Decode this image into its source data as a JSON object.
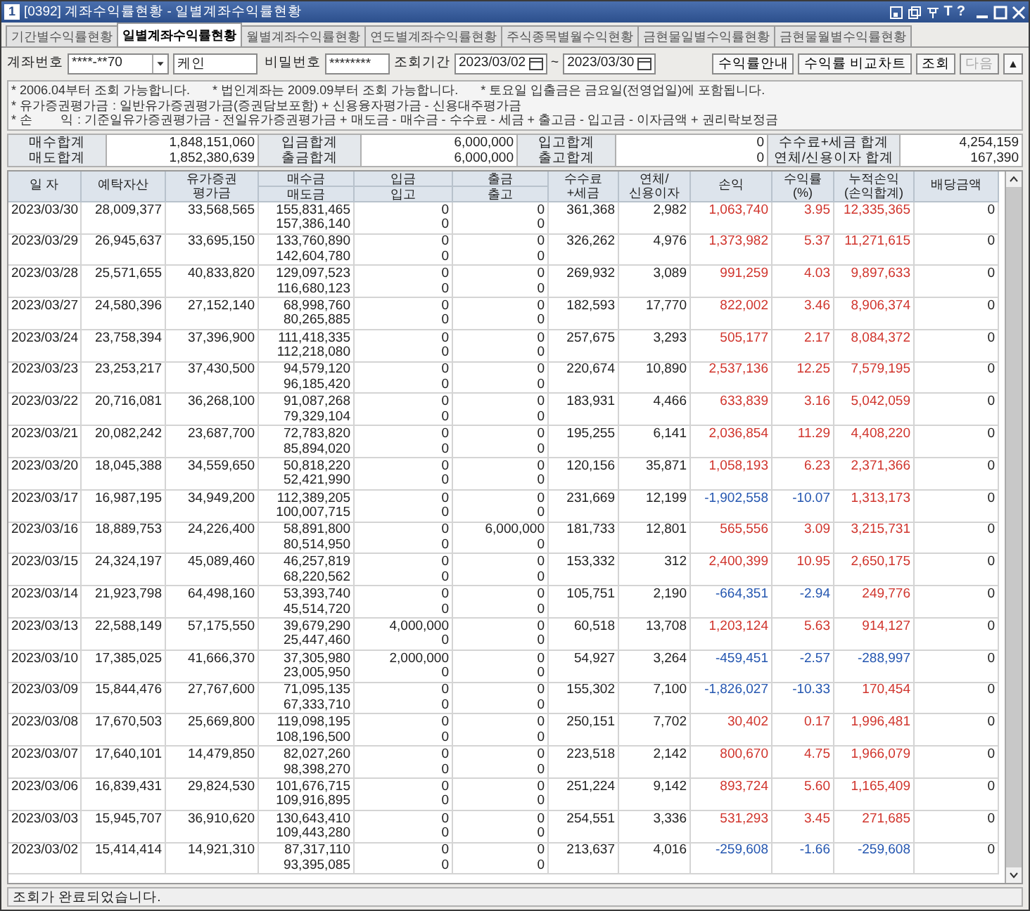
{
  "window": {
    "badge": "1",
    "title": "[0392] 계좌수익률현황 - 일별계좌수익률현황",
    "letter_button": "T",
    "help_button": "?"
  },
  "tabs": [
    {
      "label": "기간별수익률현황",
      "selected": false
    },
    {
      "label": "일별계좌수익률현황",
      "selected": true
    },
    {
      "label": "월별계좌수익률현황",
      "selected": false
    },
    {
      "label": "연도별계좌수익률현황",
      "selected": false
    },
    {
      "label": "주식종목별월수익현황",
      "selected": false
    },
    {
      "label": "금현물일별수익률현황",
      "selected": false
    },
    {
      "label": "금현물월별수익률현황",
      "selected": false
    }
  ],
  "query": {
    "account_label": "계좌번호",
    "account": "****-**70",
    "owner": "케인",
    "password_label": "비밀번호",
    "password": "********",
    "period_label": "조회기간",
    "from": "2023/03/02",
    "separator": "~",
    "to": "2023/03/30",
    "buttons": [
      {
        "label": "수익률안내",
        "disabled": false
      },
      {
        "label": "수익률 비교차트",
        "disabled": false
      },
      {
        "label": "조회",
        "disabled": false
      },
      {
        "label": "다음",
        "disabled": true
      }
    ],
    "collapse": "▲"
  },
  "notes": {
    "info": [
      "* 2006.04부터 조회 가능합니다.",
      "* 법인계좌는 2009.09부터 조회 가능합니다.",
      "* 토요일 입출금은 금요일(전영업일)에 포함됩니다."
    ],
    "formulas": [
      {
        "label": "* 유가증권평가금",
        "text": ": 일반유가증권평가금(증권담보포함) + 신용융자평가금 - 신용대주평가금"
      },
      {
        "label": "* 손        익",
        "text": ": 기준일유가증권평가금 - 전일유가증권평가금 + 매도금 - 매수금 - 수수료 - 세금 + 출고금 - 입고금 - 이자금액 + 권리락보정금"
      }
    ]
  },
  "summary": [
    [
      {
        "label": "매수합계",
        "value": "1,848,151,060"
      },
      {
        "label": "입금합계",
        "value": "6,000,000"
      },
      {
        "label": "입고합계",
        "value": "0"
      },
      {
        "label": "수수료+세금 합계",
        "value": "4,254,159"
      }
    ],
    [
      {
        "label": "매도합계",
        "value": "1,852,380,639"
      },
      {
        "label": "출금합계",
        "value": "6,000,000"
      },
      {
        "label": "출고합계",
        "value": "0"
      },
      {
        "label": "연체/신용이자 합계",
        "value": "167,390"
      }
    ]
  ],
  "table": {
    "columns": [
      {
        "kind": "single",
        "lines": [
          "일 자"
        ]
      },
      {
        "kind": "single",
        "lines": [
          "예탁자산"
        ]
      },
      {
        "kind": "stacked",
        "lines": [
          "유가증권",
          "평가금"
        ]
      },
      {
        "kind": "split",
        "lines": [
          "매수금",
          "매도금"
        ]
      },
      {
        "kind": "split",
        "lines": [
          "입금",
          "입고"
        ]
      },
      {
        "kind": "split",
        "lines": [
          "출금",
          "출고"
        ]
      },
      {
        "kind": "stacked",
        "lines": [
          "수수료",
          "+세금"
        ]
      },
      {
        "kind": "stacked",
        "lines": [
          "연체/",
          "신용이자"
        ]
      },
      {
        "kind": "single",
        "lines": [
          "손익"
        ]
      },
      {
        "kind": "stacked",
        "lines": [
          "수익률",
          "(%)"
        ]
      },
      {
        "kind": "stacked",
        "lines": [
          "누적손익",
          "(손익합계)"
        ]
      },
      {
        "kind": "single",
        "lines": [
          "배당금액"
        ]
      }
    ],
    "rows": [
      {
        "date": "2023/03/30",
        "deposit": "28,009,377",
        "valuation": "33,568,565",
        "buy": "155,831,465",
        "sell": "157,386,140",
        "cash_in": "0",
        "stock_in": "0",
        "cash_out": "0",
        "stock_out": "0",
        "fee": "361,368",
        "interest": "2,982",
        "pl": {
          "text": "1,063,740",
          "color": "#d0342c"
        },
        "rate": {
          "text": "3.95",
          "color": "#d0342c"
        },
        "cum": {
          "text": "12,335,365",
          "color": "#d0342c"
        },
        "dividend": "0"
      },
      {
        "date": "2023/03/29",
        "deposit": "26,945,637",
        "valuation": "33,695,150",
        "buy": "133,760,890",
        "sell": "142,604,780",
        "cash_in": "0",
        "stock_in": "0",
        "cash_out": "0",
        "stock_out": "0",
        "fee": "326,262",
        "interest": "4,976",
        "pl": {
          "text": "1,373,982",
          "color": "#d0342c"
        },
        "rate": {
          "text": "5.37",
          "color": "#d0342c"
        },
        "cum": {
          "text": "11,271,615",
          "color": "#d0342c"
        },
        "dividend": "0"
      },
      {
        "date": "2023/03/28",
        "deposit": "25,571,655",
        "valuation": "40,833,820",
        "buy": "129,097,523",
        "sell": "116,680,123",
        "cash_in": "0",
        "stock_in": "0",
        "cash_out": "0",
        "stock_out": "0",
        "fee": "269,932",
        "interest": "3,089",
        "pl": {
          "text": "991,259",
          "color": "#d0342c"
        },
        "rate": {
          "text": "4.03",
          "color": "#d0342c"
        },
        "cum": {
          "text": "9,897,633",
          "color": "#d0342c"
        },
        "dividend": "0"
      },
      {
        "date": "2023/03/27",
        "deposit": "24,580,396",
        "valuation": "27,152,140",
        "buy": "68,998,760",
        "sell": "80,265,885",
        "cash_in": "0",
        "stock_in": "0",
        "cash_out": "0",
        "stock_out": "0",
        "fee": "182,593",
        "interest": "17,770",
        "pl": {
          "text": "822,002",
          "color": "#d0342c"
        },
        "rate": {
          "text": "3.46",
          "color": "#d0342c"
        },
        "cum": {
          "text": "8,906,374",
          "color": "#d0342c"
        },
        "dividend": "0"
      },
      {
        "date": "2023/03/24",
        "deposit": "23,758,394",
        "valuation": "37,396,900",
        "buy": "111,418,335",
        "sell": "112,218,080",
        "cash_in": "0",
        "stock_in": "0",
        "cash_out": "0",
        "stock_out": "0",
        "fee": "257,675",
        "interest": "3,293",
        "pl": {
          "text": "505,177",
          "color": "#d0342c"
        },
        "rate": {
          "text": "2.17",
          "color": "#d0342c"
        },
        "cum": {
          "text": "8,084,372",
          "color": "#d0342c"
        },
        "dividend": "0"
      },
      {
        "date": "2023/03/23",
        "deposit": "23,253,217",
        "valuation": "37,430,500",
        "buy": "94,579,120",
        "sell": "96,185,420",
        "cash_in": "0",
        "stock_in": "0",
        "cash_out": "0",
        "stock_out": "0",
        "fee": "220,674",
        "interest": "10,890",
        "pl": {
          "text": "2,537,136",
          "color": "#d0342c"
        },
        "rate": {
          "text": "12.25",
          "color": "#d0342c"
        },
        "cum": {
          "text": "7,579,195",
          "color": "#d0342c"
        },
        "dividend": "0"
      },
      {
        "date": "2023/03/22",
        "deposit": "20,716,081",
        "valuation": "36,268,100",
        "buy": "91,087,268",
        "sell": "79,329,104",
        "cash_in": "0",
        "stock_in": "0",
        "cash_out": "0",
        "stock_out": "0",
        "fee": "183,931",
        "interest": "4,466",
        "pl": {
          "text": "633,839",
          "color": "#d0342c"
        },
        "rate": {
          "text": "3.16",
          "color": "#d0342c"
        },
        "cum": {
          "text": "5,042,059",
          "color": "#d0342c"
        },
        "dividend": "0"
      },
      {
        "date": "2023/03/21",
        "deposit": "20,082,242",
        "valuation": "23,687,700",
        "buy": "72,783,820",
        "sell": "85,894,020",
        "cash_in": "0",
        "stock_in": "0",
        "cash_out": "0",
        "stock_out": "0",
        "fee": "195,255",
        "interest": "6,141",
        "pl": {
          "text": "2,036,854",
          "color": "#d0342c"
        },
        "rate": {
          "text": "11.29",
          "color": "#d0342c"
        },
        "cum": {
          "text": "4,408,220",
          "color": "#d0342c"
        },
        "dividend": "0"
      },
      {
        "date": "2023/03/20",
        "deposit": "18,045,388",
        "valuation": "34,559,650",
        "buy": "50,818,220",
        "sell": "52,421,990",
        "cash_in": "0",
        "stock_in": "0",
        "cash_out": "0",
        "stock_out": "0",
        "fee": "120,156",
        "interest": "35,871",
        "pl": {
          "text": "1,058,193",
          "color": "#d0342c"
        },
        "rate": {
          "text": "6.23",
          "color": "#d0342c"
        },
        "cum": {
          "text": "2,371,366",
          "color": "#d0342c"
        },
        "dividend": "0"
      },
      {
        "date": "2023/03/17",
        "deposit": "16,987,195",
        "valuation": "34,949,200",
        "buy": "112,389,205",
        "sell": "100,007,715",
        "cash_in": "0",
        "stock_in": "0",
        "cash_out": "0",
        "stock_out": "0",
        "fee": "231,669",
        "interest": "12,199",
        "pl": {
          "text": "-1,902,558",
          "color": "#2456b0"
        },
        "rate": {
          "text": "-10.07",
          "color": "#2456b0"
        },
        "cum": {
          "text": "1,313,173",
          "color": "#d0342c"
        },
        "dividend": "0"
      },
      {
        "date": "2023/03/16",
        "deposit": "18,889,753",
        "valuation": "24,226,400",
        "buy": "58,891,800",
        "sell": "80,514,950",
        "cash_in": "0",
        "stock_in": "0",
        "cash_out": "6,000,000",
        "stock_out": "0",
        "fee": "181,733",
        "interest": "12,801",
        "pl": {
          "text": "565,556",
          "color": "#d0342c"
        },
        "rate": {
          "text": "3.09",
          "color": "#d0342c"
        },
        "cum": {
          "text": "3,215,731",
          "color": "#d0342c"
        },
        "dividend": "0"
      },
      {
        "date": "2023/03/15",
        "deposit": "24,324,197",
        "valuation": "45,089,460",
        "buy": "46,257,819",
        "sell": "68,220,562",
        "cash_in": "0",
        "stock_in": "0",
        "cash_out": "0",
        "stock_out": "0",
        "fee": "153,332",
        "interest": "312",
        "pl": {
          "text": "2,400,399",
          "color": "#d0342c"
        },
        "rate": {
          "text": "10.95",
          "color": "#d0342c"
        },
        "cum": {
          "text": "2,650,175",
          "color": "#d0342c"
        },
        "dividend": "0"
      },
      {
        "date": "2023/03/14",
        "deposit": "21,923,798",
        "valuation": "64,498,160",
        "buy": "53,393,740",
        "sell": "45,514,720",
        "cash_in": "0",
        "stock_in": "0",
        "cash_out": "0",
        "stock_out": "0",
        "fee": "105,751",
        "interest": "2,190",
        "pl": {
          "text": "-664,351",
          "color": "#2456b0"
        },
        "rate": {
          "text": "-2.94",
          "color": "#2456b0"
        },
        "cum": {
          "text": "249,776",
          "color": "#d0342c"
        },
        "dividend": "0"
      },
      {
        "date": "2023/03/13",
        "deposit": "22,588,149",
        "valuation": "57,175,550",
        "buy": "39,679,290",
        "sell": "25,447,460",
        "cash_in": "4,000,000",
        "stock_in": "0",
        "cash_out": "0",
        "stock_out": "0",
        "fee": "60,518",
        "interest": "13,708",
        "pl": {
          "text": "1,203,124",
          "color": "#d0342c"
        },
        "rate": {
          "text": "5.63",
          "color": "#d0342c"
        },
        "cum": {
          "text": "914,127",
          "color": "#d0342c"
        },
        "dividend": "0"
      },
      {
        "date": "2023/03/10",
        "deposit": "17,385,025",
        "valuation": "41,666,370",
        "buy": "37,305,980",
        "sell": "23,005,950",
        "cash_in": "2,000,000",
        "stock_in": "0",
        "cash_out": "0",
        "stock_out": "0",
        "fee": "54,927",
        "interest": "3,264",
        "pl": {
          "text": "-459,451",
          "color": "#2456b0"
        },
        "rate": {
          "text": "-2.57",
          "color": "#2456b0"
        },
        "cum": {
          "text": "-288,997",
          "color": "#2456b0"
        },
        "dividend": "0"
      },
      {
        "date": "2023/03/09",
        "deposit": "15,844,476",
        "valuation": "27,767,600",
        "buy": "71,095,135",
        "sell": "67,333,710",
        "cash_in": "0",
        "stock_in": "0",
        "cash_out": "0",
        "stock_out": "0",
        "fee": "155,302",
        "interest": "7,100",
        "pl": {
          "text": "-1,826,027",
          "color": "#2456b0"
        },
        "rate": {
          "text": "-10.33",
          "color": "#2456b0"
        },
        "cum": {
          "text": "170,454",
          "color": "#d0342c"
        },
        "dividend": "0"
      },
      {
        "date": "2023/03/08",
        "deposit": "17,670,503",
        "valuation": "25,669,800",
        "buy": "119,098,195",
        "sell": "108,196,500",
        "cash_in": "0",
        "stock_in": "0",
        "cash_out": "0",
        "stock_out": "0",
        "fee": "250,151",
        "interest": "7,702",
        "pl": {
          "text": "30,402",
          "color": "#d0342c"
        },
        "rate": {
          "text": "0.17",
          "color": "#d0342c"
        },
        "cum": {
          "text": "1,996,481",
          "color": "#d0342c"
        },
        "dividend": "0"
      },
      {
        "date": "2023/03/07",
        "deposit": "17,640,101",
        "valuation": "14,479,850",
        "buy": "82,027,260",
        "sell": "98,398,270",
        "cash_in": "0",
        "stock_in": "0",
        "cash_out": "0",
        "stock_out": "0",
        "fee": "223,518",
        "interest": "2,142",
        "pl": {
          "text": "800,670",
          "color": "#d0342c"
        },
        "rate": {
          "text": "4.75",
          "color": "#d0342c"
        },
        "cum": {
          "text": "1,966,079",
          "color": "#d0342c"
        },
        "dividend": "0"
      },
      {
        "date": "2023/03/06",
        "deposit": "16,839,431",
        "valuation": "29,824,530",
        "buy": "101,676,715",
        "sell": "109,916,895",
        "cash_in": "0",
        "stock_in": "0",
        "cash_out": "0",
        "stock_out": "0",
        "fee": "251,224",
        "interest": "9,142",
        "pl": {
          "text": "893,724",
          "color": "#d0342c"
        },
        "rate": {
          "text": "5.60",
          "color": "#d0342c"
        },
        "cum": {
          "text": "1,165,409",
          "color": "#d0342c"
        },
        "dividend": "0"
      },
      {
        "date": "2023/03/03",
        "deposit": "15,945,707",
        "valuation": "36,910,620",
        "buy": "130,643,410",
        "sell": "109,443,280",
        "cash_in": "0",
        "stock_in": "0",
        "cash_out": "0",
        "stock_out": "0",
        "fee": "254,551",
        "interest": "3,336",
        "pl": {
          "text": "531,293",
          "color": "#d0342c"
        },
        "rate": {
          "text": "3.45",
          "color": "#d0342c"
        },
        "cum": {
          "text": "271,685",
          "color": "#d0342c"
        },
        "dividend": "0"
      },
      {
        "date": "2023/03/02",
        "deposit": "15,414,414",
        "valuation": "14,921,310",
        "buy": "87,317,110",
        "sell": "93,395,085",
        "cash_in": "0",
        "stock_in": "0",
        "cash_out": "0",
        "stock_out": "0",
        "fee": "213,637",
        "interest": "4,016",
        "pl": {
          "text": "-259,608",
          "color": "#2456b0"
        },
        "rate": {
          "text": "-1.66",
          "color": "#2456b0"
        },
        "cum": {
          "text": "-259,608",
          "color": "#2456b0"
        },
        "dividend": "0"
      }
    ]
  },
  "status_bar": "조회가 완료되었습니다."
}
